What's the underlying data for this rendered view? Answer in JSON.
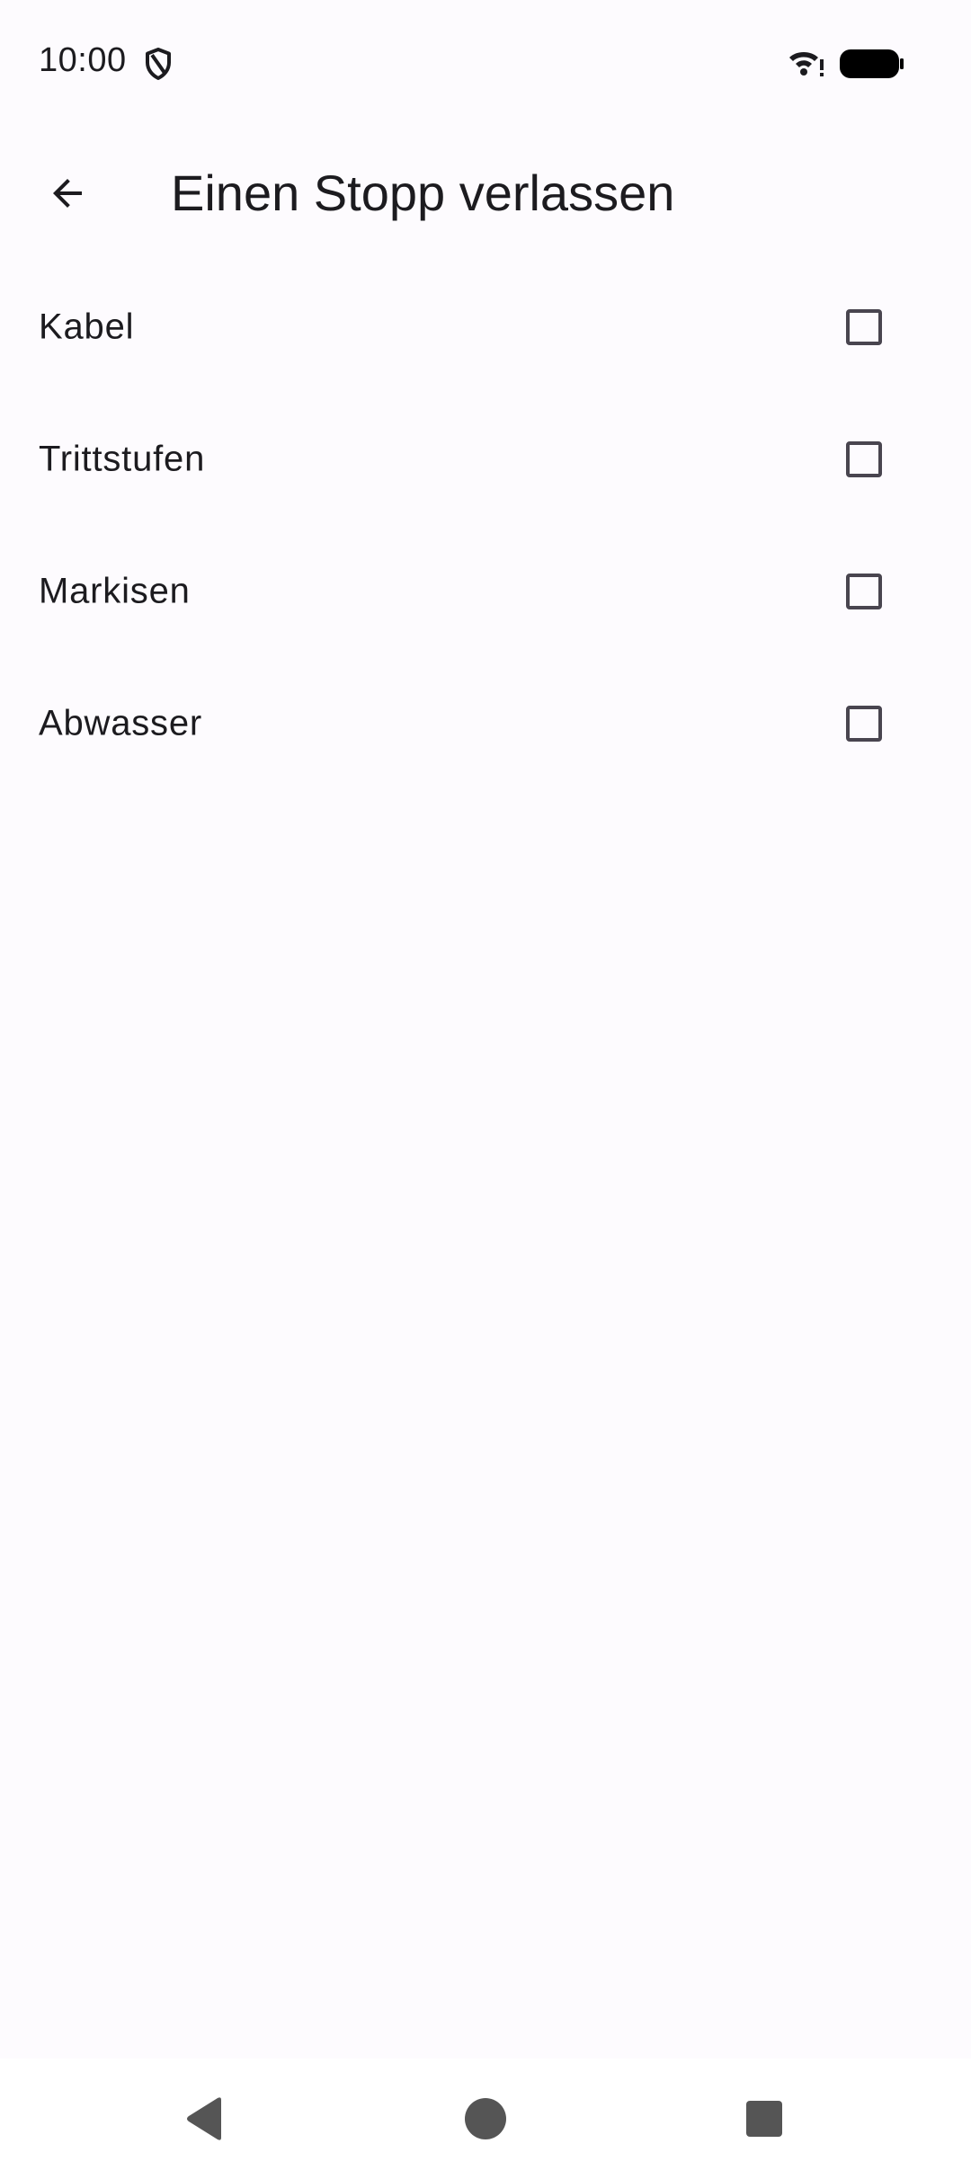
{
  "status_bar": {
    "time": "10:00",
    "icons": [
      "shield-icon",
      "wifi-alert-icon",
      "battery-full-icon"
    ]
  },
  "app_bar": {
    "title": "Einen Stopp verlassen",
    "back_icon": "arrow-back-icon"
  },
  "list": {
    "items": [
      {
        "label": "Kabel",
        "checked": false
      },
      {
        "label": "Trittstufen",
        "checked": false
      },
      {
        "label": "Markisen",
        "checked": false
      },
      {
        "label": "Abwasser",
        "checked": false
      }
    ]
  },
  "nav_bar": {
    "buttons": [
      "back-triangle-icon",
      "home-circle-icon",
      "recents-square-icon"
    ]
  },
  "colors": {
    "background": "#fdfbfe",
    "text": "#1c1b1f",
    "checkbox_border": "#49454f",
    "nav_icon": "#555555"
  }
}
